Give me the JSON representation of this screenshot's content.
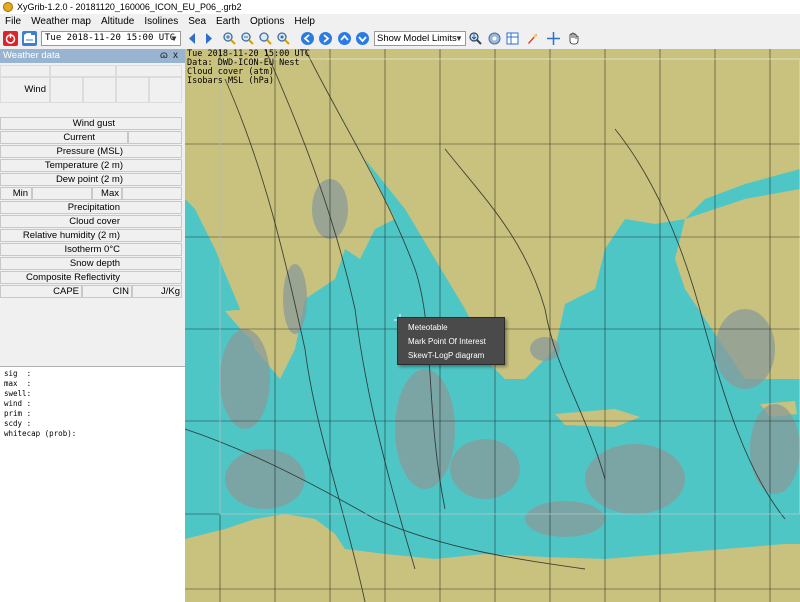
{
  "window": {
    "title": "XyGrib-1.2.0 - 20181120_160006_ICON_EU_P06_.grb2"
  },
  "menubar": {
    "items": [
      "File",
      "Weather map",
      "Altitude",
      "Isolines",
      "Sea",
      "Earth",
      "Options",
      "Help"
    ]
  },
  "toolbar": {
    "date_value": "Tue 2018-11-20 15:00 UTC",
    "model_select": "Show Model Limits",
    "icons": [
      "power-icon",
      "open-file-icon",
      "prev-icon",
      "next-icon",
      "zoom-in-icon",
      "zoom-out-icon",
      "zoom-selection-icon",
      "zoom-all-icon",
      "arrow-left-icon",
      "arrow-right-icon",
      "arrow-up-icon",
      "arrow-down-icon",
      "download-icon",
      "settings-icon",
      "meteotable-icon",
      "rocket-icon",
      "crosshair-icon",
      "hand-icon"
    ]
  },
  "weather_panel": {
    "title": "Weather data",
    "close": "x",
    "float": "ɷ",
    "rows": {
      "wind": "Wind",
      "wind_gust": "Wind gust",
      "current": "Current",
      "pressure": "Pressure (MSL)",
      "temperature": "Temperature (2 m)",
      "dew_point": "Dew point (2 m)",
      "min": "Min",
      "max": "Max",
      "precipitation": "Precipitation",
      "cloud_cover": "Cloud cover",
      "relative_humidity": "Relative humidity (2 m)",
      "isotherm": "Isotherm 0°C",
      "snow_depth": "Snow depth",
      "composite_reflectivity": "Composite Reflectivity",
      "cape": "CAPE",
      "cin": "CIN",
      "cape_unit": "J/Kg"
    },
    "wave_lines": [
      "sig  :",
      "max  :",
      "swell:",
      "wind :",
      "prim :",
      "scdy :",
      "whitecap (prob):"
    ]
  },
  "map": {
    "legend": [
      "Tue 2018-11-20 15:00 UTC",
      "Data: DWD-ICON-EU Nest",
      "Cloud cover (atm)",
      "Isobars MSL (hPa)"
    ],
    "colors": {
      "sea": "#4fc6c6",
      "land": "#c8c27e",
      "cloud": "#8a9a9a"
    }
  },
  "context_menu": {
    "items": [
      "Meteotable",
      "Mark Point Of Interest",
      "SkewT-LogP diagram"
    ]
  }
}
